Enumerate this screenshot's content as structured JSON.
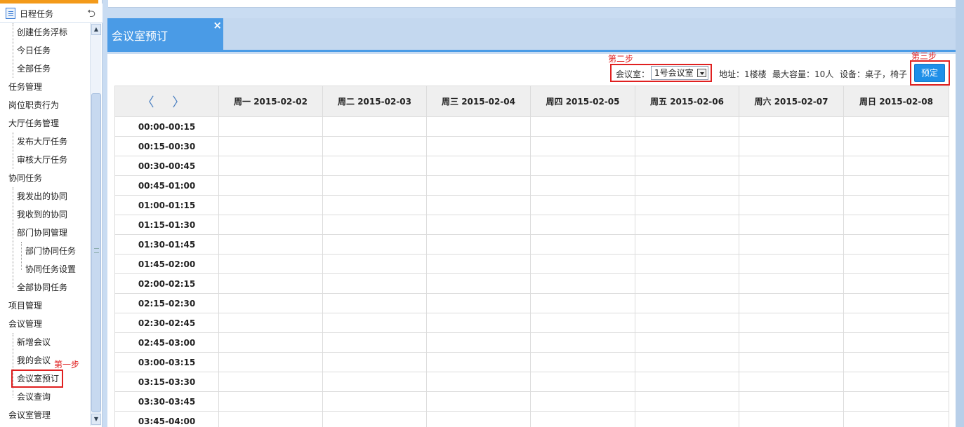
{
  "sidebar": {
    "title": "日程任务",
    "items": [
      "创建任务浮标",
      "今日任务",
      "全部任务",
      "任务管理",
      "岗位职责行为",
      "大厅任务管理",
      "发布大厅任务",
      "审核大厅任务",
      "协同任务",
      "我发出的协同",
      "我收到的协同",
      "部门协同管理",
      "部门协同任务",
      "协同任务设置",
      "全部协同任务",
      "项目管理",
      "会议管理",
      "新增会议",
      "我的会议",
      "会议室预订",
      "会议查询",
      "会议室管理"
    ]
  },
  "annotations": {
    "step1": "第一步",
    "step2": "第二步",
    "step3": "第三步"
  },
  "tab": {
    "label": "会议室预订",
    "close": "×"
  },
  "toolbar": {
    "room_label": "会议室：",
    "room_value": "1号会议室",
    "address": "地址：1楼楼",
    "capacity": "最大容量：10人",
    "equipment": "设备：桌子，椅子",
    "book_button": "预定"
  },
  "table": {
    "nav": "〈 〉",
    "headers": [
      "周一 2015-02-02",
      "周二 2015-02-03",
      "周三 2015-02-04",
      "周四 2015-02-05",
      "周五 2015-02-06",
      "周六 2015-02-07",
      "周日 2015-02-08"
    ],
    "times": [
      "00:00-00:15",
      "00:15-00:30",
      "00:30-00:45",
      "00:45-01:00",
      "01:00-01:15",
      "01:15-01:30",
      "01:30-01:45",
      "01:45-02:00",
      "02:00-02:15",
      "02:15-02:30",
      "02:30-02:45",
      "02:45-03:00",
      "03:00-03:15",
      "03:15-03:30",
      "03:30-03:45",
      "03:45-04:00"
    ]
  }
}
